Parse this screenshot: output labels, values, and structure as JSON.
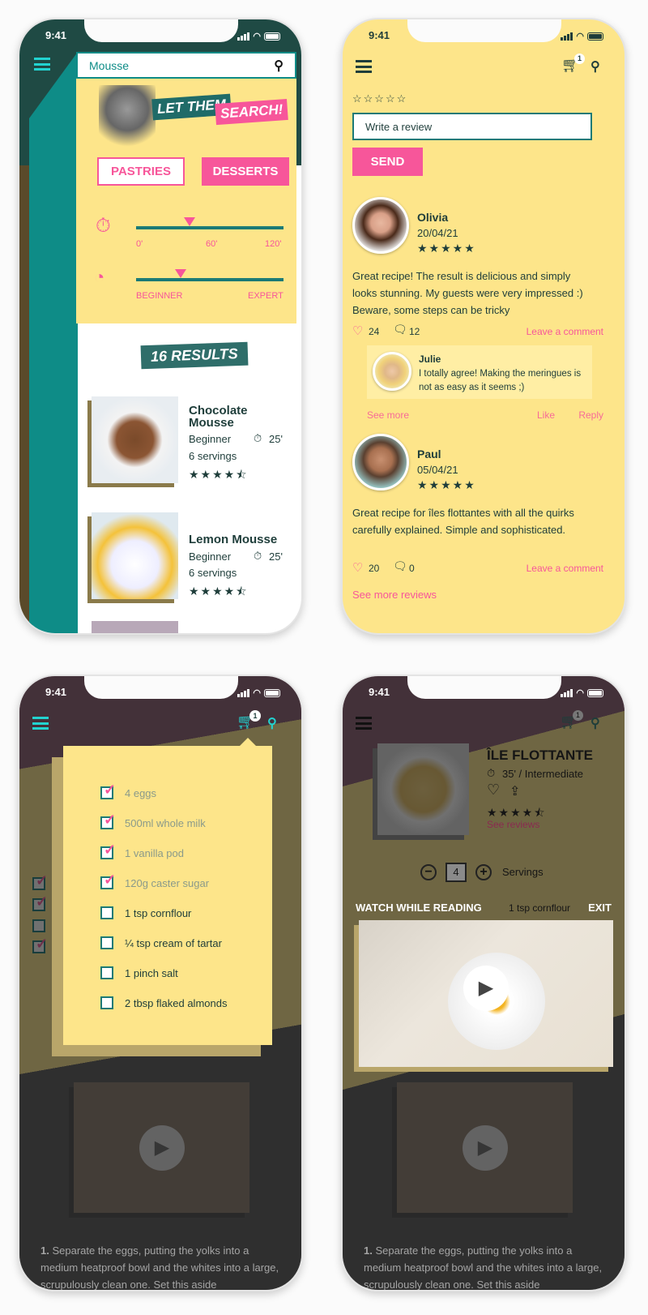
{
  "status": {
    "time": "9:41"
  },
  "colors": {
    "teal": "#0e8c87",
    "dark_green": "#1f4a44",
    "pink": "#f7569a",
    "yellow": "#fde58a",
    "text": "#1e3d3a"
  },
  "search_screen": {
    "search": {
      "value": "Mousse",
      "icon": "search-icon"
    },
    "banner": [
      "LET THEM",
      "SEARCH!"
    ],
    "categories": [
      {
        "label": "PASTRIES",
        "selected": false
      },
      {
        "label": "DESSERTS",
        "selected": true
      }
    ],
    "time_slider": {
      "icon": "stopwatch-icon",
      "labels": [
        "0'",
        "60'",
        "120'"
      ],
      "value_minutes": 35
    },
    "difficulty_slider": {
      "icon": "gauge-icon",
      "labels": [
        "BEGINNER",
        "EXPERT"
      ],
      "value_fraction": 0.3
    },
    "results_label": "16 RESULTS",
    "results": [
      {
        "name": "Chocolate Mousse",
        "level": "Beginner",
        "time": "25'",
        "servings": "6 servings",
        "rating": 4.5
      },
      {
        "name": "Lemon Mousse",
        "level": "Beginner",
        "time": "25'",
        "servings": "6 servings",
        "rating": 4.5
      }
    ]
  },
  "reviews_screen": {
    "cart_count": "1",
    "rating_input": "☆☆☆☆☆",
    "review_placeholder": "Write a review",
    "send_label": "SEND",
    "reviews": [
      {
        "name": "Olivia",
        "date": "20/04/21",
        "stars": "★★★★★",
        "text": "Great recipe! The result is delicious and simply looks stunning. My guests were very impressed :) Beware, some steps can be tricky",
        "likes": "24",
        "comments": "12",
        "leave_comment": "Leave a comment",
        "reply": {
          "name": "Julie",
          "text": "I totally agree! Making the meringues is not as easy as it seems ;)",
          "see_more": "See more",
          "like": "Like",
          "reply": "Reply"
        }
      },
      {
        "name": "Paul",
        "date": "05/04/21",
        "stars": "★★★★★",
        "text": "Great recipe for îles flottantes with all the quirks carefully explained. Simple and sophisticated.",
        "likes": "20",
        "comments": "0",
        "leave_comment": "Leave a comment"
      }
    ],
    "see_more_reviews": "See more reviews"
  },
  "shopping_list": {
    "cart_count": "1",
    "items": [
      {
        "label": "4 eggs",
        "checked": true
      },
      {
        "label": "500ml whole milk",
        "checked": true
      },
      {
        "label": "1 vanilla pod",
        "checked": true
      },
      {
        "label": "120g caster sugar",
        "checked": true
      },
      {
        "label": "1 tsp cornflour",
        "checked": false
      },
      {
        "label": "¼ tsp cream of tartar",
        "checked": false
      },
      {
        "label": "1 pinch salt",
        "checked": false
      },
      {
        "label": "2 tbsp flaked almonds",
        "checked": false
      }
    ]
  },
  "recipe_screen": {
    "cart_count": "1",
    "title": "ÎLE FLOTTANTE",
    "meta": "35' / Intermediate",
    "stars": "★★★★⯪",
    "see_reviews": "See reviews",
    "servings_value": "4",
    "servings_label": "Servings",
    "ingredient_peek": "1 tsp cornflour",
    "watch_label": "WATCH WHILE READING",
    "exit_label": "EXIT",
    "step_number": "1.",
    "step_text": "Separate the eggs, putting the yolks into a medium heatproof bowl and the whites into a large, scrupulously clean one. Set this aside"
  }
}
